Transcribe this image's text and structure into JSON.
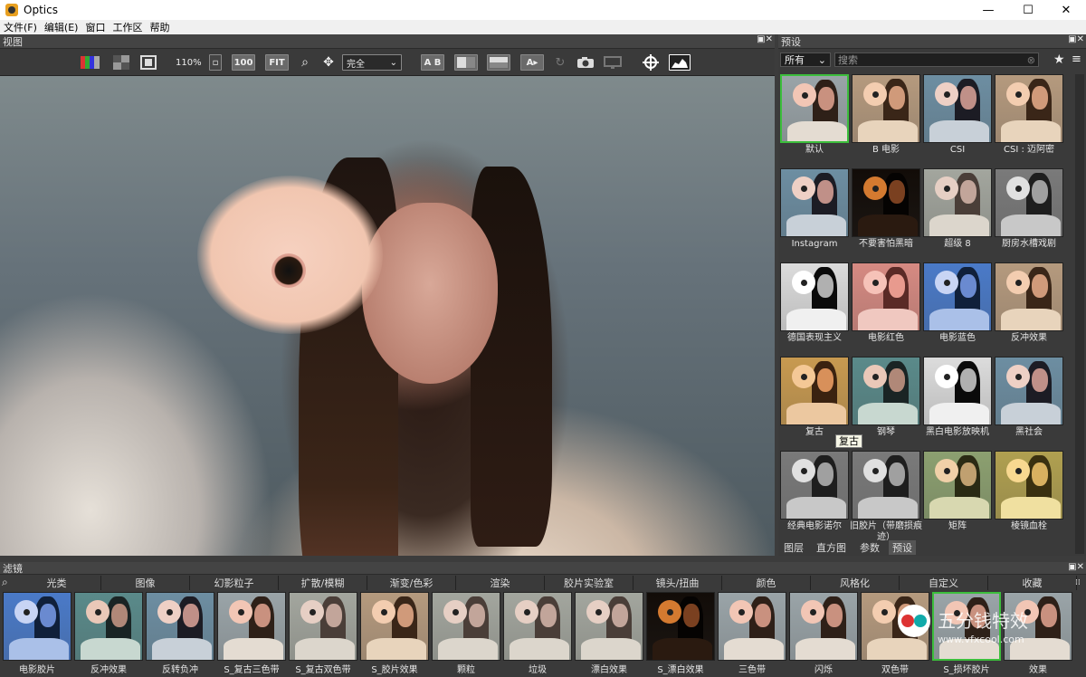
{
  "window": {
    "title": "Optics",
    "min": "—",
    "max": "☐",
    "close": "✕"
  },
  "menu": [
    "文件(F)",
    "编辑(E)",
    "窗口",
    "工作区",
    "帮助"
  ],
  "viewer": {
    "title": "视图",
    "zoom": "110%",
    "btn100": "100",
    "btnFit": "FIT",
    "mode": "完全",
    "ab": "A B"
  },
  "presets": {
    "title": "预设",
    "filter": "所有",
    "search_placeholder": "搜索",
    "items": [
      {
        "label": "默认",
        "tone": "natural",
        "selected": true
      },
      {
        "label": "B 电影",
        "tone": "warm"
      },
      {
        "label": "CSI",
        "tone": "cool"
      },
      {
        "label": "CSI : 迈阿密",
        "tone": "warm"
      },
      {
        "label": "Instagram",
        "tone": "cool"
      },
      {
        "label": "不要害怕黑暗",
        "tone": "dark"
      },
      {
        "label": "超级 8",
        "tone": "faded"
      },
      {
        "label": "厨房水槽戏剧",
        "tone": "bw"
      },
      {
        "label": "德国表现主义",
        "tone": "bwhigh"
      },
      {
        "label": "电影红色",
        "tone": "red"
      },
      {
        "label": "电影蓝色",
        "tone": "blue"
      },
      {
        "label": "反冲效果",
        "tone": "warm"
      },
      {
        "label": "复古",
        "tone": "orange"
      },
      {
        "label": "钢琴",
        "tone": "teal"
      },
      {
        "label": "黑白电影放映机",
        "tone": "bwhigh"
      },
      {
        "label": "黑社会",
        "tone": "cool"
      },
      {
        "label": "经典电影诺尔",
        "tone": "bw"
      },
      {
        "label": "旧胶片（带磨损痕迹）",
        "tone": "bw"
      },
      {
        "label": "矩阵",
        "tone": "green"
      },
      {
        "label": "棱镜血栓",
        "tone": "yellow"
      }
    ],
    "tabs": [
      "图层",
      "直方图",
      "参数",
      "预设"
    ],
    "tooltip": "复古"
  },
  "filters": {
    "title": "滤镜",
    "categories": [
      "光类",
      "图像",
      "幻影粒子",
      "扩散/模糊",
      "渐变/色彩",
      "渲染",
      "胶片实验室",
      "镜头/扭曲",
      "颜色",
      "风格化",
      "自定义",
      "收藏"
    ],
    "items": [
      {
        "label": "电影胶片",
        "tone": "blue"
      },
      {
        "label": "反冲效果",
        "tone": "teal"
      },
      {
        "label": "反转负冲",
        "tone": "cool"
      },
      {
        "label": "S_复古三色带",
        "tone": "natural"
      },
      {
        "label": "S_复古双色带",
        "tone": "faded"
      },
      {
        "label": "S_胶片效果",
        "tone": "warm"
      },
      {
        "label": "颗粒",
        "tone": "faded"
      },
      {
        "label": "垃圾",
        "tone": "faded"
      },
      {
        "label": "漂白效果",
        "tone": "faded"
      },
      {
        "label": "S_漂白效果",
        "tone": "dark"
      },
      {
        "label": "三色带",
        "tone": "natural"
      },
      {
        "label": "闪烁",
        "tone": "natural"
      },
      {
        "label": "双色带",
        "tone": "warm"
      },
      {
        "label": "S_损坏胶片",
        "tone": "natural",
        "selected": true
      },
      {
        "label": "效果",
        "tone": "natural"
      }
    ]
  },
  "watermark": {
    "text": "五分钱特效",
    "url": "www.vfxcool.com"
  }
}
